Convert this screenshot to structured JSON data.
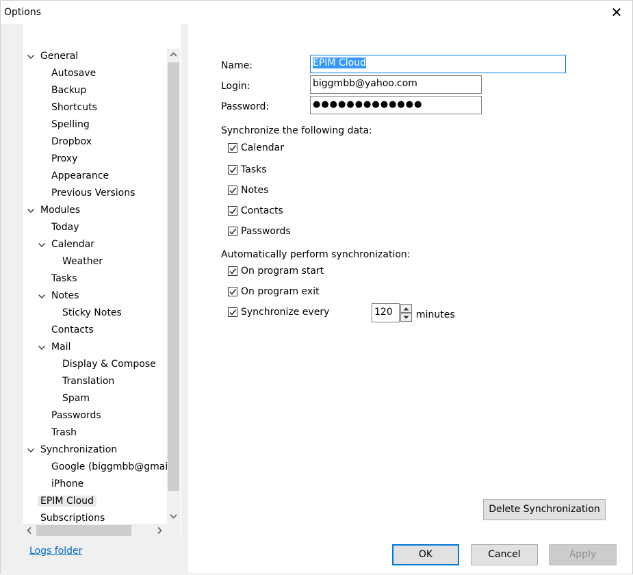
{
  "window": {
    "title": "Options"
  },
  "tree": [
    {
      "label": "General",
      "level": 0,
      "expanded": true
    },
    {
      "label": "Autosave",
      "level": 1
    },
    {
      "label": "Backup",
      "level": 1
    },
    {
      "label": "Shortcuts",
      "level": 1
    },
    {
      "label": "Spelling",
      "level": 1
    },
    {
      "label": "Dropbox",
      "level": 1
    },
    {
      "label": "Proxy",
      "level": 1
    },
    {
      "label": "Appearance",
      "level": 1
    },
    {
      "label": "Previous Versions",
      "level": 1
    },
    {
      "label": "Modules",
      "level": 0,
      "expanded": true
    },
    {
      "label": "Today",
      "level": 1
    },
    {
      "label": "Calendar",
      "level": 1,
      "expanded": true
    },
    {
      "label": "Weather",
      "level": 2
    },
    {
      "label": "Tasks",
      "level": 1
    },
    {
      "label": "Notes",
      "level": 1,
      "expanded": true
    },
    {
      "label": "Sticky Notes",
      "level": 2
    },
    {
      "label": "Contacts",
      "level": 1
    },
    {
      "label": "Mail",
      "level": 1,
      "expanded": true
    },
    {
      "label": "Display & Compose",
      "level": 2
    },
    {
      "label": "Translation",
      "level": 2
    },
    {
      "label": "Spam",
      "level": 2
    },
    {
      "label": "Passwords",
      "level": 1
    },
    {
      "label": "Trash",
      "level": 1
    },
    {
      "label": "Synchronization",
      "level": 0,
      "expanded": true
    },
    {
      "label": "Google (biggmbb@gmai",
      "level": 1
    },
    {
      "label": "iPhone",
      "level": 1
    },
    {
      "label": "EPIM Cloud",
      "level": 0,
      "selected": true
    },
    {
      "label": "Subscriptions",
      "level": 0
    }
  ],
  "links": {
    "logs_folder": "Logs folder"
  },
  "form": {
    "name_label": "Name:",
    "name_value": "EPIM Cloud",
    "login_label": "Login:",
    "login_value": "biggmbb@yahoo.com",
    "password_label": "Password:",
    "password_value": "●●●●●●●●●●●●●"
  },
  "sync_data": {
    "heading": "Synchronize the following data:",
    "items": [
      {
        "label": "Calendar",
        "checked": true
      },
      {
        "label": "Tasks",
        "checked": true
      },
      {
        "label": "Notes",
        "checked": true
      },
      {
        "label": "Contacts",
        "checked": true
      },
      {
        "label": "Passwords",
        "checked": true
      }
    ]
  },
  "auto_sync": {
    "heading": "Automatically perform synchronization:",
    "items": [
      {
        "label": "On program start",
        "checked": true
      },
      {
        "label": "On program exit",
        "checked": true
      },
      {
        "label": "Synchronize every",
        "checked": true
      }
    ],
    "interval_value": "120",
    "interval_unit": "minutes"
  },
  "buttons": {
    "delete_sync": "Delete Synchronization",
    "ok": "OK",
    "cancel": "Cancel",
    "apply": "Apply"
  },
  "colors": {
    "accent": "#0078d7",
    "selection": "#3399ff",
    "link": "#0066cc"
  }
}
